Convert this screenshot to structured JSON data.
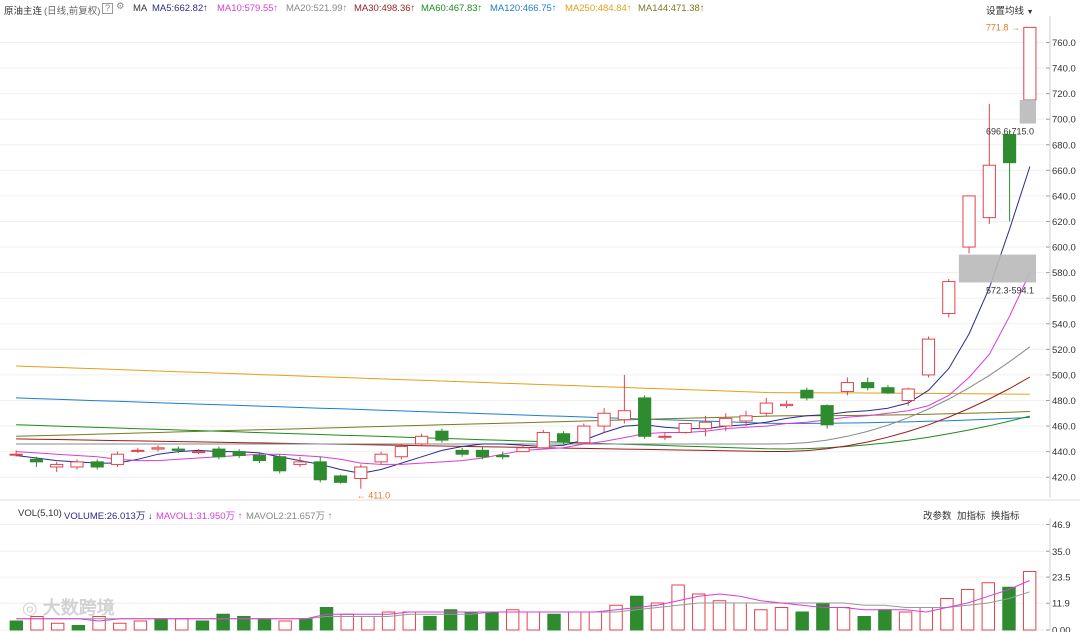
{
  "header": {
    "instrument": "原油主连",
    "period": "(日线,前复权)",
    "help": "?",
    "ma_label": "MA",
    "ma": [
      {
        "text": "MA5:662.82",
        "color": "#2b2b8c"
      },
      {
        "text": "MA10:579.55",
        "color": "#d63fd6"
      },
      {
        "text": "MA20:521.99",
        "color": "#888888"
      },
      {
        "text": "MA30:498.36",
        "color": "#9b1c1c"
      },
      {
        "text": "MA60:467.83",
        "color": "#1e8a1e"
      },
      {
        "text": "MA120:466.75",
        "color": "#1c7fc9"
      },
      {
        "text": "MA250:484.84",
        "color": "#e3a01b"
      },
      {
        "text": "MA144:471.38",
        "color": "#7a7a1e"
      }
    ],
    "arrow": "↑",
    "settings": "设置均线"
  },
  "volume_header": {
    "label": "VOL(5,10)",
    "volume": "VOLUME:26.013万",
    "volume_arrow": "↓",
    "mavol1": "MAVOL1:31.950万",
    "mavol2": "MAVOL2:21.657万",
    "arrow": "↑",
    "buttons": [
      "改参数",
      "加指标",
      "换指标"
    ]
  },
  "annotations": {
    "high": "771.8",
    "low": "411.0",
    "zone_upper": "696.6-715.0",
    "zone_lower": "572.3-594.1"
  },
  "watermark": "大数跨境",
  "colors": {
    "up": "#e0454b",
    "down": "#2e8b2e",
    "grid": "#efefef",
    "zone": "#b9b9b9"
  },
  "chart_data": [
    {
      "type": "candlestick",
      "y_ticks": [
        420,
        440,
        460,
        480,
        500,
        520,
        540,
        560,
        580,
        600,
        620,
        640,
        660,
        680,
        700,
        720,
        740,
        760
      ],
      "ylim": [
        410,
        776
      ],
      "candles": [
        {
          "o": 438,
          "h": 441,
          "l": 436,
          "c": 438
        },
        {
          "o": 434,
          "h": 436,
          "l": 428,
          "c": 432
        },
        {
          "o": 428,
          "h": 432,
          "l": 424,
          "c": 430
        },
        {
          "o": 428,
          "h": 434,
          "l": 426,
          "c": 432
        },
        {
          "o": 432,
          "h": 434,
          "l": 426,
          "c": 428
        },
        {
          "o": 430,
          "h": 440,
          "l": 428,
          "c": 438
        },
        {
          "o": 441,
          "h": 443,
          "l": 439,
          "c": 441
        },
        {
          "o": 442,
          "h": 445,
          "l": 440,
          "c": 443
        },
        {
          "o": 442,
          "h": 444,
          "l": 439,
          "c": 441
        },
        {
          "o": 440,
          "h": 442,
          "l": 438,
          "c": 440
        },
        {
          "o": 442,
          "h": 444,
          "l": 434,
          "c": 436
        },
        {
          "o": 440,
          "h": 442,
          "l": 435,
          "c": 437
        },
        {
          "o": 437,
          "h": 439,
          "l": 431,
          "c": 433
        },
        {
          "o": 436,
          "h": 438,
          "l": 423,
          "c": 425
        },
        {
          "o": 430,
          "h": 436,
          "l": 428,
          "c": 432
        },
        {
          "o": 432,
          "h": 436,
          "l": 416,
          "c": 418
        },
        {
          "o": 421,
          "h": 422,
          "l": 415,
          "c": 416
        },
        {
          "o": 419,
          "h": 430,
          "l": 411,
          "c": 428
        },
        {
          "o": 432,
          "h": 440,
          "l": 430,
          "c": 438
        },
        {
          "o": 436,
          "h": 446,
          "l": 434,
          "c": 444
        },
        {
          "o": 446,
          "h": 454,
          "l": 445,
          "c": 452
        },
        {
          "o": 456,
          "h": 458,
          "l": 447,
          "c": 449
        },
        {
          "o": 441,
          "h": 443,
          "l": 436,
          "c": 438
        },
        {
          "o": 441,
          "h": 444,
          "l": 434,
          "c": 436
        },
        {
          "o": 437,
          "h": 440,
          "l": 434,
          "c": 436
        },
        {
          "o": 440,
          "h": 445,
          "l": 440,
          "c": 443
        },
        {
          "o": 443,
          "h": 457,
          "l": 443,
          "c": 455
        },
        {
          "o": 454,
          "h": 456,
          "l": 446,
          "c": 448
        },
        {
          "o": 447,
          "h": 462,
          "l": 446,
          "c": 460
        },
        {
          "o": 460,
          "h": 474,
          "l": 455,
          "c": 470
        },
        {
          "o": 465,
          "h": 500,
          "l": 462,
          "c": 472
        },
        {
          "o": 482,
          "h": 484,
          "l": 450,
          "c": 452
        },
        {
          "o": 452,
          "h": 455,
          "l": 449,
          "c": 452
        },
        {
          "o": 455,
          "h": 462,
          "l": 454,
          "c": 462
        },
        {
          "o": 458,
          "h": 468,
          "l": 452,
          "c": 463
        },
        {
          "o": 460,
          "h": 470,
          "l": 456,
          "c": 466
        },
        {
          "o": 464,
          "h": 472,
          "l": 460,
          "c": 468
        },
        {
          "o": 470,
          "h": 482,
          "l": 468,
          "c": 478
        },
        {
          "o": 476,
          "h": 480,
          "l": 474,
          "c": 477
        },
        {
          "o": 488,
          "h": 490,
          "l": 480,
          "c": 482
        },
        {
          "o": 476,
          "h": 477,
          "l": 458,
          "c": 461
        },
        {
          "o": 487,
          "h": 498,
          "l": 484,
          "c": 494
        },
        {
          "o": 494,
          "h": 498,
          "l": 488,
          "c": 490
        },
        {
          "o": 490,
          "h": 492,
          "l": 485,
          "c": 486
        },
        {
          "o": 480,
          "h": 490,
          "l": 476,
          "c": 489
        },
        {
          "o": 500,
          "h": 530,
          "l": 498,
          "c": 528
        },
        {
          "o": 548,
          "h": 575,
          "l": 545,
          "c": 573
        },
        {
          "o": 600,
          "h": 640,
          "l": 595,
          "c": 640
        },
        {
          "o": 623,
          "h": 712,
          "l": 618,
          "c": 664
        },
        {
          "o": 688,
          "h": 692,
          "l": 620,
          "c": 666
        },
        {
          "o": 715,
          "h": 772,
          "l": 714,
          "c": 771.8
        }
      ],
      "ma_lines": [
        {
          "name": "MA5",
          "values": [
            437,
            435,
            433,
            432,
            431,
            431,
            434,
            438,
            440,
            441,
            440,
            440,
            439,
            436,
            433,
            430,
            426,
            423,
            426,
            431,
            436,
            441,
            444,
            446,
            446,
            445,
            444,
            445,
            449,
            455,
            460,
            461,
            459,
            458,
            458,
            460,
            461,
            463,
            466,
            468,
            469,
            471,
            472,
            474,
            478,
            488,
            505,
            532,
            568,
            614,
            663
          ]
        },
        {
          "name": "MA10",
          "values": [
            440,
            439,
            438,
            437,
            436,
            434,
            433,
            433,
            434,
            435,
            436,
            437,
            438,
            438,
            437,
            436,
            434,
            431,
            430,
            430,
            431,
            432,
            433,
            435,
            438,
            441,
            442,
            443,
            446,
            448,
            451,
            454,
            455,
            455,
            456,
            458,
            459,
            460,
            462,
            463,
            465,
            467,
            468,
            470,
            472,
            476,
            484,
            498,
            516,
            546,
            580
          ]
        }
      ]
    },
    {
      "type": "bar",
      "title": "VOL(5,10)",
      "y_ticks": [
        0.0,
        11.9,
        23.5,
        35.0,
        46.9
      ],
      "ylim": [
        0,
        48
      ],
      "values": [
        4,
        6,
        3,
        2,
        6,
        3,
        4,
        5,
        5,
        4,
        7,
        6,
        5,
        4,
        5,
        10,
        7,
        6,
        8,
        8,
        6,
        9,
        8,
        8,
        9,
        8,
        7,
        8,
        8,
        11,
        15,
        12,
        20,
        16,
        13,
        12,
        9,
        10,
        8,
        12,
        10,
        6,
        9,
        8,
        10,
        14,
        18,
        21,
        19,
        26
      ],
      "mavol1": [
        5,
        5,
        5,
        5,
        4,
        5,
        5,
        5,
        5,
        5,
        5,
        5,
        5,
        5,
        5,
        7,
        7,
        7,
        7,
        8,
        8,
        8,
        8,
        8,
        8,
        8,
        8,
        8,
        8,
        9,
        10,
        11,
        13,
        15,
        16,
        15,
        13,
        12,
        11,
        10,
        10,
        9,
        9,
        9,
        8,
        10,
        12,
        15,
        18,
        22,
        32
      ],
      "mavol2": [
        5,
        5,
        5,
        5,
        5,
        5,
        5,
        5,
        5,
        5,
        5,
        5,
        5,
        5,
        5,
        6,
        6,
        6,
        6,
        7,
        7,
        7,
        7,
        8,
        8,
        8,
        8,
        8,
        8,
        8,
        9,
        10,
        11,
        12,
        12,
        12,
        12,
        12,
        12,
        12,
        12,
        11,
        11,
        10,
        10,
        10,
        11,
        12,
        14,
        17,
        22
      ]
    }
  ]
}
